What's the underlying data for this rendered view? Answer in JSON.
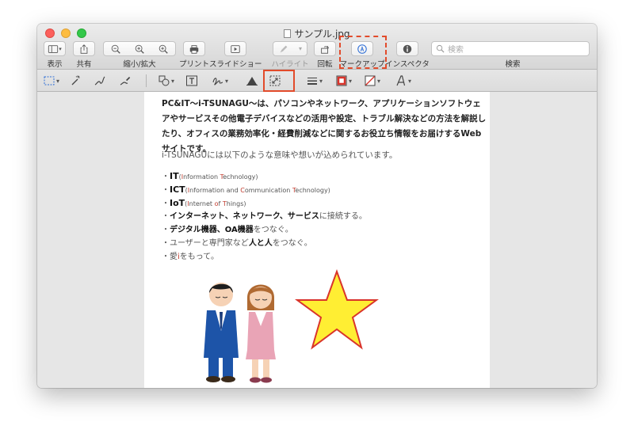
{
  "window": {
    "title": "サンプル.jpg"
  },
  "toolbar": {
    "view_label": "表示",
    "share_label": "共有",
    "zoom_label": "縮小/拡大",
    "print_label": "プリント",
    "slideshow_label": "スライドショー",
    "highlight_label": "ハイライト",
    "rotate_label": "回転",
    "markup_label": "マークアップ",
    "inspector_label": "インスペクタ",
    "search_label": "検索",
    "search_placeholder": "検索"
  },
  "document": {
    "intro": "PC&IT〜i-TSUNAGU〜は、パソコンやネットワーク、アプリケーションソフトウェアやサービスその他電子デバイスなどの活用や設定、トラブル解決などの方法を解説したり、オフィスの業務効率化・経費削減などに関するお役立ち情報をお届けするWebサイトです。",
    "meaning": "i-TSUNAGUには以下のような意味や想いが込められています。",
    "items": [
      {
        "prefix": "・",
        "main": "IT",
        "note_parts": [
          "(",
          "I",
          "nformation ",
          "T",
          "echnology)"
        ]
      },
      {
        "prefix": "・",
        "main": "ICT",
        "note_parts": [
          "(",
          "I",
          "nformation and ",
          "C",
          "ommunication ",
          "T",
          "echnology)"
        ]
      },
      {
        "prefix": "・",
        "main": "IoT",
        "note_parts": [
          "(",
          "I",
          "nternet ",
          "o",
          "f ",
          "T",
          "hings)"
        ]
      },
      {
        "prefix": "・",
        "main": "インターネット、ネットワーク、サービス",
        "rest": "に接続する。"
      },
      {
        "prefix": "・",
        "main": "デジタル機器、OA機器",
        "rest": "をつなぐ。"
      },
      {
        "prefix": "・",
        "pre": "ユーザーと専門家など",
        "main": "人と人",
        "rest": "をつなぐ。"
      },
      {
        "prefix": "・",
        "pre": "愛",
        "red": "i",
        "rest": "をもって。"
      }
    ]
  },
  "colors": {
    "highlight_box": "#e24b2b",
    "star_fill": "#ffee33",
    "star_stroke": "#d9342b"
  }
}
